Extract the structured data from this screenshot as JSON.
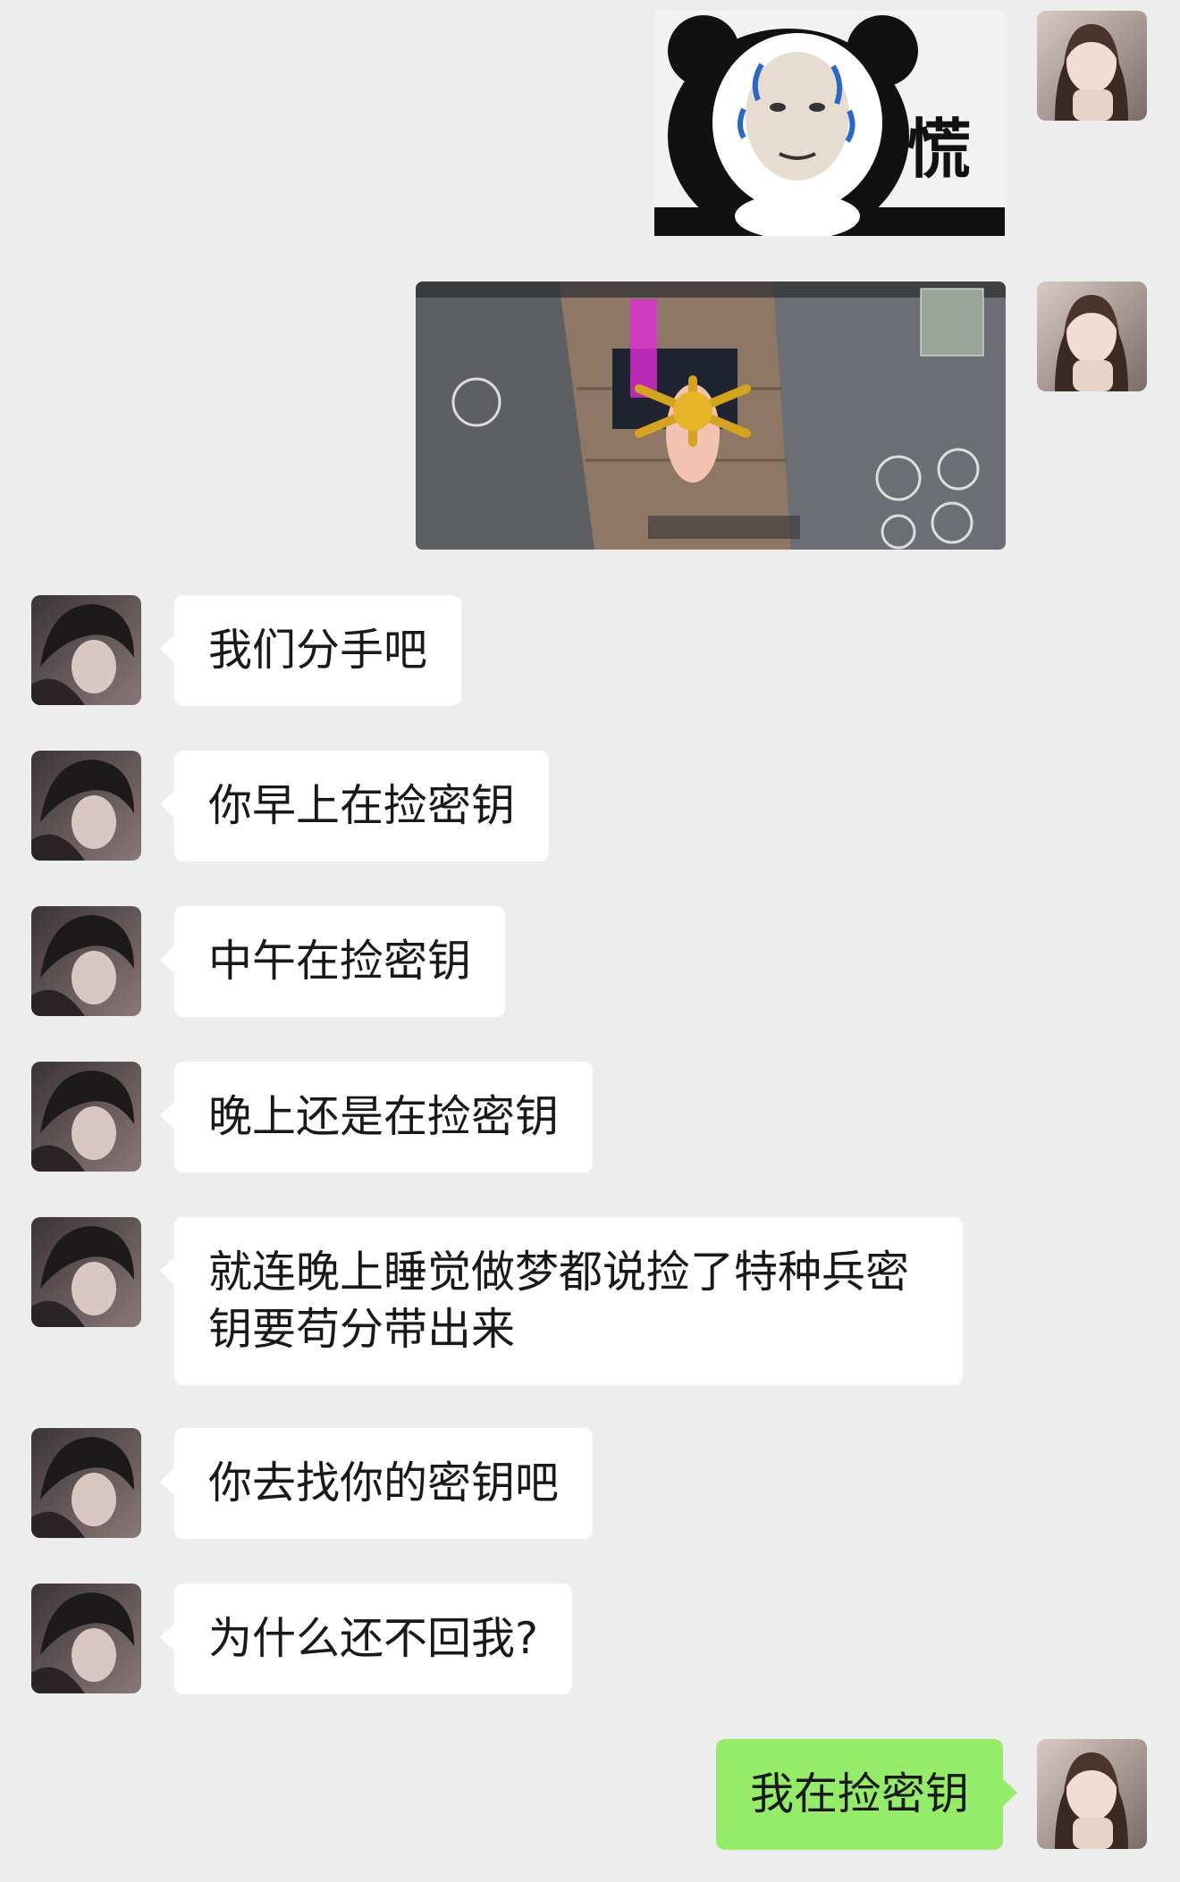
{
  "messages": [
    {
      "side": "right",
      "type": "sticker",
      "text": "慌"
    },
    {
      "side": "right",
      "type": "image",
      "alt": "game screenshot"
    },
    {
      "side": "left",
      "type": "text",
      "text": "我们分手吧"
    },
    {
      "side": "left",
      "type": "text",
      "text": "你早上在捡密钥"
    },
    {
      "side": "left",
      "type": "text",
      "text": "中午在捡密钥"
    },
    {
      "side": "left",
      "type": "text",
      "text": "晚上还是在捡密钥"
    },
    {
      "side": "left",
      "type": "text",
      "line1": "就连晚上睡觉做梦都说捡了特种兵密",
      "line2": "钥要苟分带出来"
    },
    {
      "side": "left",
      "type": "text",
      "text": "你去找你的密钥吧"
    },
    {
      "side": "left",
      "type": "text",
      "text": "为什么还不回我?"
    },
    {
      "side": "right",
      "type": "text",
      "text": "我在捡密钥"
    }
  ],
  "colors": {
    "background": "#ededed",
    "left_bubble": "#ffffff",
    "right_bubble": "#95ec69"
  }
}
